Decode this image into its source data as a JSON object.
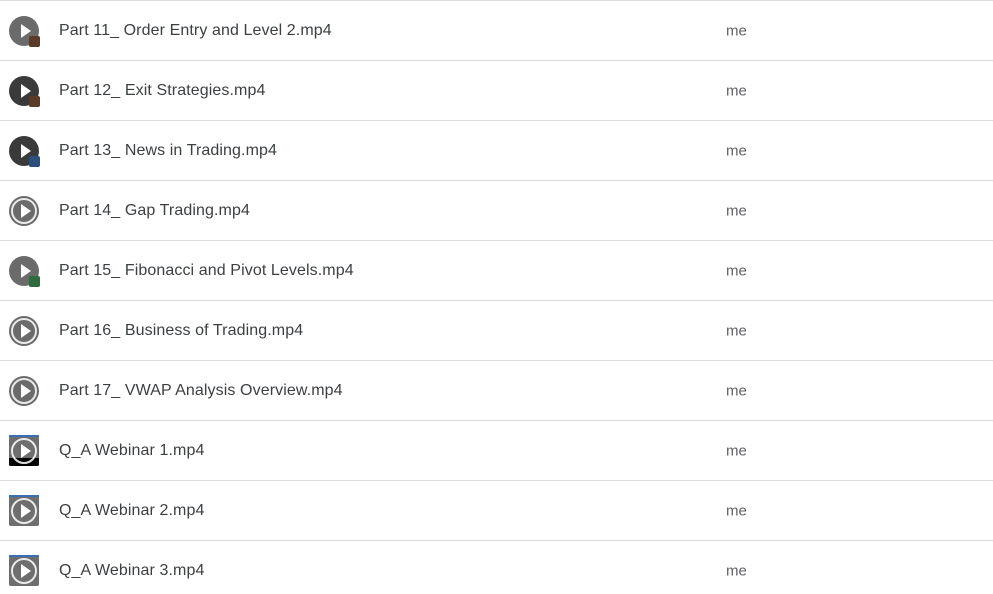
{
  "files": [
    {
      "name": "Part 11_ Order Entry and Level 2.mp4",
      "owner": "me",
      "icon": "video-thumbnail-icon"
    },
    {
      "name": "Part 12_ Exit Strategies.mp4",
      "owner": "me",
      "icon": "video-thumbnail-icon"
    },
    {
      "name": "Part 13_ News in Trading.mp4",
      "owner": "me",
      "icon": "video-thumbnail-icon"
    },
    {
      "name": "Part 14_ Gap Trading.mp4",
      "owner": "me",
      "icon": "video-thumbnail-icon"
    },
    {
      "name": "Part 15_ Fibonacci and Pivot Levels.mp4",
      "owner": "me",
      "icon": "video-thumbnail-icon"
    },
    {
      "name": "Part 16_ Business of Trading.mp4",
      "owner": "me",
      "icon": "video-thumbnail-icon"
    },
    {
      "name": "Part 17_ VWAP Analysis Overview.mp4",
      "owner": "me",
      "icon": "video-thumbnail-icon"
    },
    {
      "name": "Q_A Webinar 1.mp4",
      "owner": "me",
      "icon": "video-thumbnail-icon"
    },
    {
      "name": "Q_A Webinar 2.mp4",
      "owner": "me",
      "icon": "video-thumbnail-icon"
    },
    {
      "name": "Q_A Webinar 3.mp4",
      "owner": "me",
      "icon": "video-thumbnail-icon"
    }
  ],
  "colors": {
    "text_primary": "#3c4043",
    "text_secondary": "#5f6368",
    "divider": "#dadce0"
  }
}
